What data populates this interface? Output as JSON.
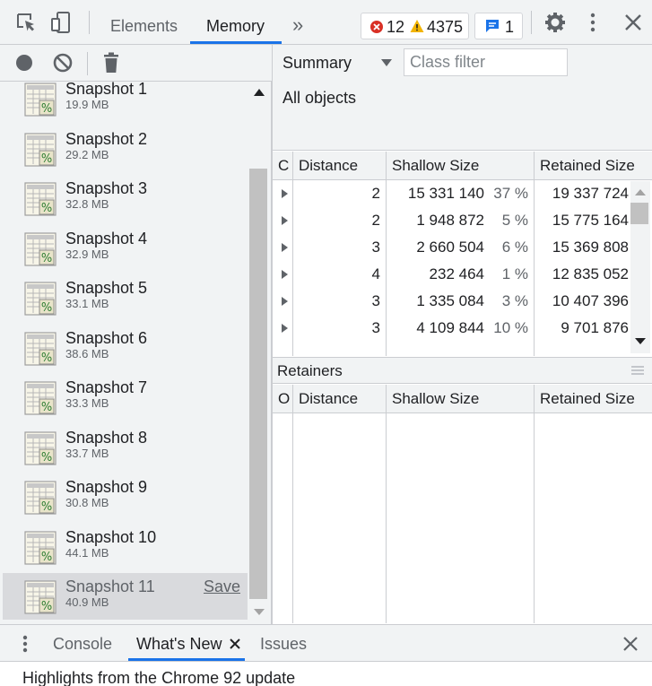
{
  "toolbar": {
    "tabs": [
      "Elements",
      "Memory"
    ],
    "more_icon": "double-chevron-right-icon",
    "errors_count": "12",
    "warnings_count": "4375",
    "messages_count": "1"
  },
  "profiles_toolbar": {
    "record_icon": "record-icon",
    "clear_icon": "clear-icon",
    "delete_icon": "trash-icon"
  },
  "snapshots": [
    {
      "name": "Snapshot 1",
      "size": "19.9 MB"
    },
    {
      "name": "Snapshot 2",
      "size": "29.2 MB"
    },
    {
      "name": "Snapshot 3",
      "size": "32.8 MB"
    },
    {
      "name": "Snapshot 4",
      "size": "32.9 MB"
    },
    {
      "name": "Snapshot 5",
      "size": "33.1 MB"
    },
    {
      "name": "Snapshot 6",
      "size": "38.6 MB"
    },
    {
      "name": "Snapshot 7",
      "size": "33.3 MB"
    },
    {
      "name": "Snapshot 8",
      "size": "33.7 MB"
    },
    {
      "name": "Snapshot 9",
      "size": "30.8 MB"
    },
    {
      "name": "Snapshot 10",
      "size": "44.1 MB"
    },
    {
      "name": "Snapshot 11",
      "size": "40.9 MB",
      "save_label": "Save"
    }
  ],
  "summary": {
    "view_label": "Summary",
    "class_filter_placeholder": "Class filter",
    "objects_label": "All objects"
  },
  "grid": {
    "headers": [
      "C",
      "Distance",
      "Shallow Size",
      "Retained Size"
    ],
    "rows": [
      {
        "distance": "2",
        "shallow": "15 331 140",
        "shallow_pct": "37 %",
        "retained": "19 337 724"
      },
      {
        "distance": "2",
        "shallow": "1 948 872",
        "shallow_pct": "5 %",
        "retained": "15 775 164"
      },
      {
        "distance": "3",
        "shallow": "2 660 504",
        "shallow_pct": "6 %",
        "retained": "15 369 808"
      },
      {
        "distance": "4",
        "shallow": "232 464",
        "shallow_pct": "1 %",
        "retained": "12 835 052"
      },
      {
        "distance": "3",
        "shallow": "1 335 084",
        "shallow_pct": "3 %",
        "retained": "10 407 396"
      },
      {
        "distance": "3",
        "shallow": "4 109 844",
        "shallow_pct": "10 %",
        "retained": "9 701 876"
      }
    ]
  },
  "retainers": {
    "title": "Retainers",
    "headers": [
      "O",
      "Distance",
      "Shallow Size",
      "Retained Size"
    ]
  },
  "drawer": {
    "tabs": [
      "Console",
      "What's New",
      "Issues"
    ],
    "content": "Highlights from the Chrome 92 update"
  }
}
